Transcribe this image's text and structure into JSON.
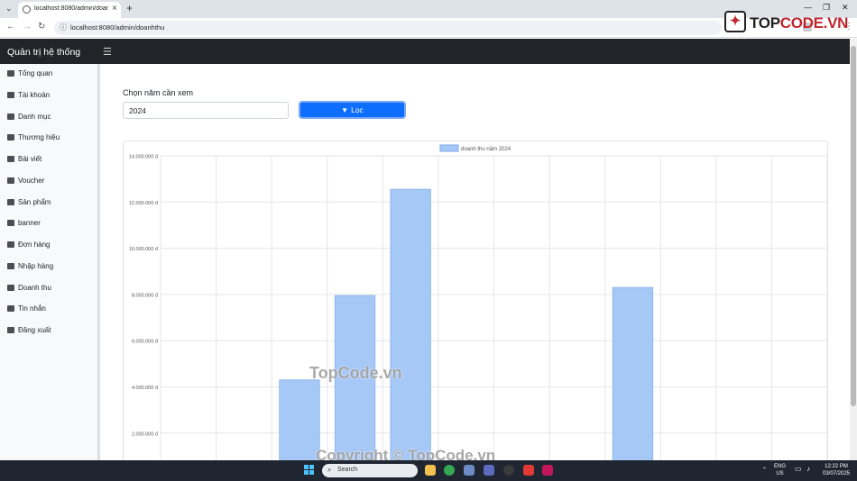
{
  "browser": {
    "tab_title": "localhost:8080/admin/doanhthu",
    "url": "localhost:8080/admin/doanhthu"
  },
  "app": {
    "brand": "Quản trị hệ thống",
    "logo_text_left": "TOP",
    "logo_text_right": "CODE.VN"
  },
  "sidebar": {
    "items": [
      {
        "label": "Tổng quan",
        "icon": "dashboard-icon"
      },
      {
        "label": "Tài khoản",
        "icon": "user-icon"
      },
      {
        "label": "Danh mục",
        "icon": "table-icon"
      },
      {
        "label": "Thương hiệu",
        "icon": "table-icon"
      },
      {
        "label": "Bài viết",
        "icon": "newspaper-icon"
      },
      {
        "label": "Voucher",
        "icon": "ticket-icon"
      },
      {
        "label": "Sản phẩm",
        "icon": "shirt-icon"
      },
      {
        "label": "banner",
        "icon": "image-icon"
      },
      {
        "label": "Đơn hàng",
        "icon": "cart-icon"
      },
      {
        "label": "Nhập hàng",
        "icon": "cart-icon"
      },
      {
        "label": "Doanh thu",
        "icon": "chart-icon"
      },
      {
        "label": "Tin nhắn",
        "icon": "chat-icon"
      },
      {
        "label": "Đăng xuất",
        "icon": "sign-out-icon"
      }
    ]
  },
  "filter": {
    "label": "Chọn năm cần xem",
    "year_value": "2024",
    "button_label": "Lọc"
  },
  "chart_data": {
    "type": "bar",
    "legend": [
      "doanh thu năm 2024"
    ],
    "legend_position": "top",
    "series": [
      {
        "name": "doanh thu năm 2024",
        "values": [
          0,
          0,
          4300000,
          7950000,
          12550000,
          0,
          0,
          0,
          8300000,
          0,
          0,
          0
        ]
      }
    ],
    "y_ticks": [
      "14.000.000 đ",
      "12.000.000 đ",
      "10.000.000 đ",
      "8.000.000 đ",
      "6.000.000 đ",
      "4.000.000 đ",
      "2.000.000 đ"
    ],
    "ylim": [
      0,
      14000000
    ],
    "grid": true,
    "bar_color": "#a6c8f7"
  },
  "watermarks": {
    "center": "TopCode.vn",
    "bottom": "Copyright © TopCode.vn"
  },
  "taskbar": {
    "search_placeholder": "Search",
    "lang_top": "ENG",
    "lang_bottom": "US",
    "time": "12:22 PM",
    "date": "03/07/2025"
  }
}
